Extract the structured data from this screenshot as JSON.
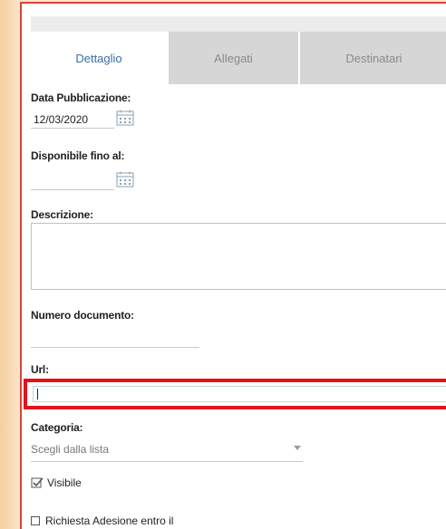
{
  "tabs": [
    {
      "label": "Dettaglio",
      "active": true
    },
    {
      "label": "Allegati",
      "active": false
    },
    {
      "label": "Destinatari",
      "active": false
    }
  ],
  "form": {
    "data_pubblicazione": {
      "label": "Data Pubblicazione:",
      "value": "12/03/2020"
    },
    "disponibile_fino": {
      "label": "Disponibile fino al:",
      "value": ""
    },
    "descrizione": {
      "label": "Descrizione:",
      "value": ""
    },
    "numero_documento": {
      "label": "Numero documento:",
      "value": ""
    },
    "url": {
      "label": "Url:",
      "value": ""
    },
    "categoria": {
      "label": "Categoria:",
      "selected": "Scegli dalla lista"
    },
    "visibile": {
      "label": "Visibile",
      "checked": true
    },
    "richiesta_adesione": {
      "label": "Richiesta Adesione entro il",
      "checked": false
    }
  },
  "icons": [
    "calendar-icon",
    "dropdown-arrow-icon",
    "checkmark-icon"
  ],
  "colors": {
    "highlight": "#e1141b",
    "accent_border": "#d9443a",
    "tab_active_text": "#3a6ea5",
    "textarea_border": "#9fcfd0"
  }
}
